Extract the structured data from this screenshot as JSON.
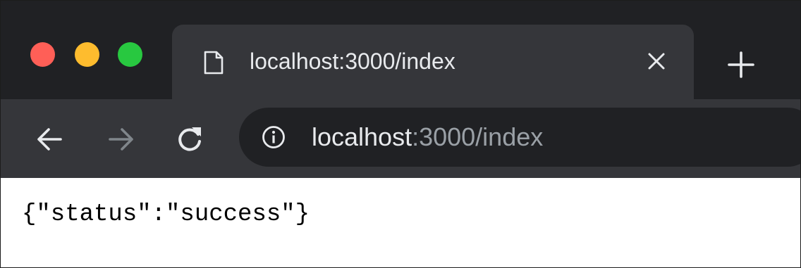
{
  "window": {
    "traffic_lights": {
      "close": "#ff5f57",
      "minimize": "#febc2e",
      "zoom": "#28c840"
    }
  },
  "tab": {
    "icon": "document-icon",
    "title": "localhost:3000/index",
    "close_icon": "close-icon",
    "new_tab_icon": "plus-icon"
  },
  "toolbar": {
    "back_icon": "arrow-left-icon",
    "forward_icon": "arrow-right-icon",
    "reload_icon": "reload-icon",
    "address": {
      "info_icon": "info-icon",
      "host": "localhost",
      "path": ":3000/index"
    }
  },
  "page": {
    "body_text": "{\"status\":\"success\"}"
  },
  "colors": {
    "titlebar": "#202124",
    "toolbar": "#35363a",
    "omnibox": "#202124",
    "text_primary": "#e8eaed",
    "text_secondary": "#9aa0a6"
  }
}
